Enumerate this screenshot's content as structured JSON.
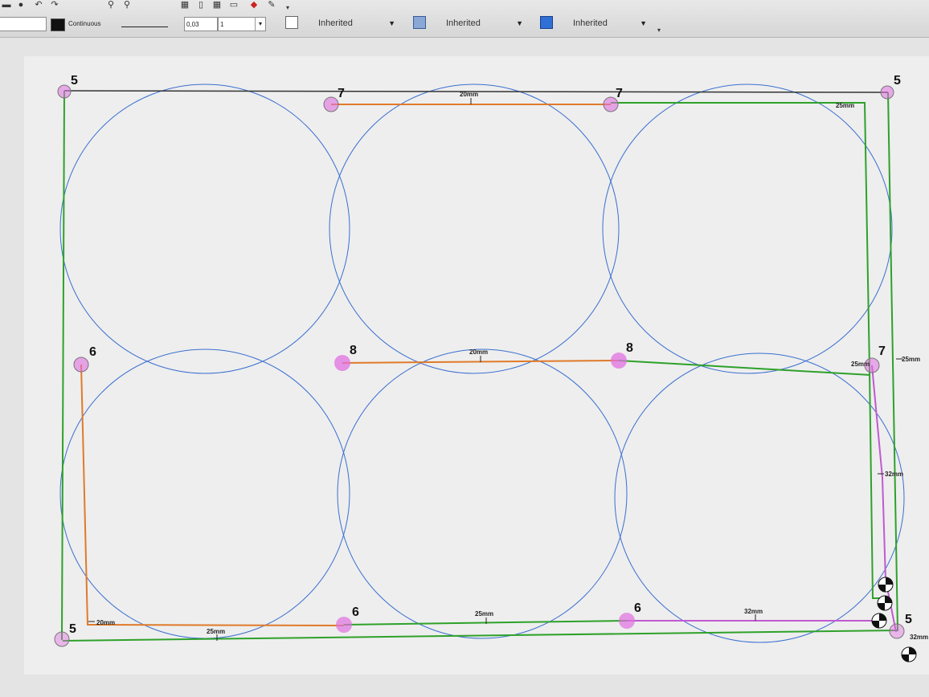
{
  "toolbar": {
    "linetype": "Continuous",
    "lineweight": "0,03",
    "scale": "1",
    "dropdown1": "Inherited",
    "dropdown2": "Inherited",
    "dropdown3": "Inherited"
  },
  "drawing": {
    "node_labels": [
      "5",
      "7",
      "7",
      "5",
      "6",
      "8",
      "8",
      "7",
      "5",
      "6",
      "6",
      "5"
    ],
    "dimensions": [
      "20mm",
      "20mm",
      "25mm",
      "25mm",
      "25mm",
      "32mm",
      "20mm",
      "25mm",
      "25mm",
      "32mm",
      "32mm"
    ]
  },
  "colors": {
    "circle": "#3a6fd0",
    "green_line": "#2ea12a",
    "orange_line": "#e07a2a",
    "magenta_line": "#c05ad0",
    "marker": "#e070e0"
  }
}
